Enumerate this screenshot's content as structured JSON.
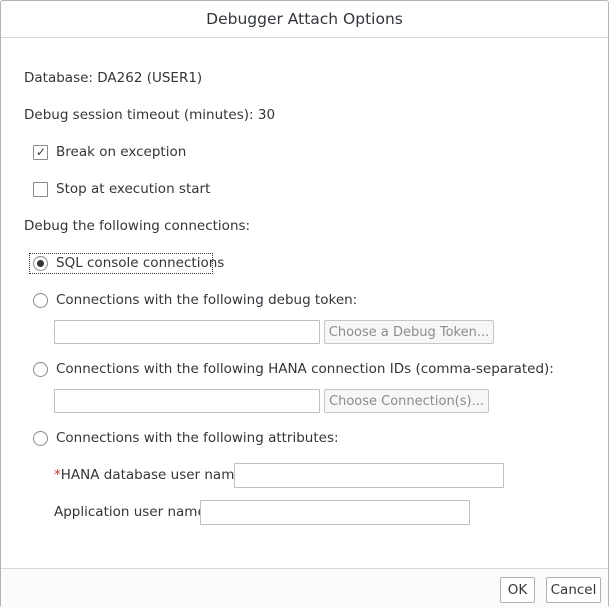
{
  "dialog": {
    "title": "Debugger Attach Options"
  },
  "info": {
    "database": "Database: DA262 (USER1)",
    "timeout": "Debug session timeout (minutes): 30"
  },
  "options": {
    "break_on_exception": {
      "label": "Break on exception",
      "checked": true
    },
    "stop_at_start": {
      "label": "Stop at execution start",
      "checked": false
    }
  },
  "connections": {
    "heading": "Debug the following connections:",
    "sql_console": {
      "label": "SQL console connections",
      "selected": true
    },
    "debug_token": {
      "label": "Connections with the following debug token:",
      "input_value": "",
      "button_label": "Choose a Debug Token..."
    },
    "connection_ids": {
      "label": "Connections with the following HANA connection IDs (comma-separated):",
      "input_value": "",
      "button_label": "Choose Connection(s)..."
    },
    "attributes": {
      "label": "Connections with the following attributes:",
      "required_marker": "*",
      "hana_user_label": "HANA database user name:",
      "hana_user_value": "",
      "app_user_label": "Application user name:",
      "app_user_value": ""
    }
  },
  "footer": {
    "ok_label": "OK",
    "cancel_label": "Cancel"
  },
  "icons": {
    "check": "✓"
  }
}
